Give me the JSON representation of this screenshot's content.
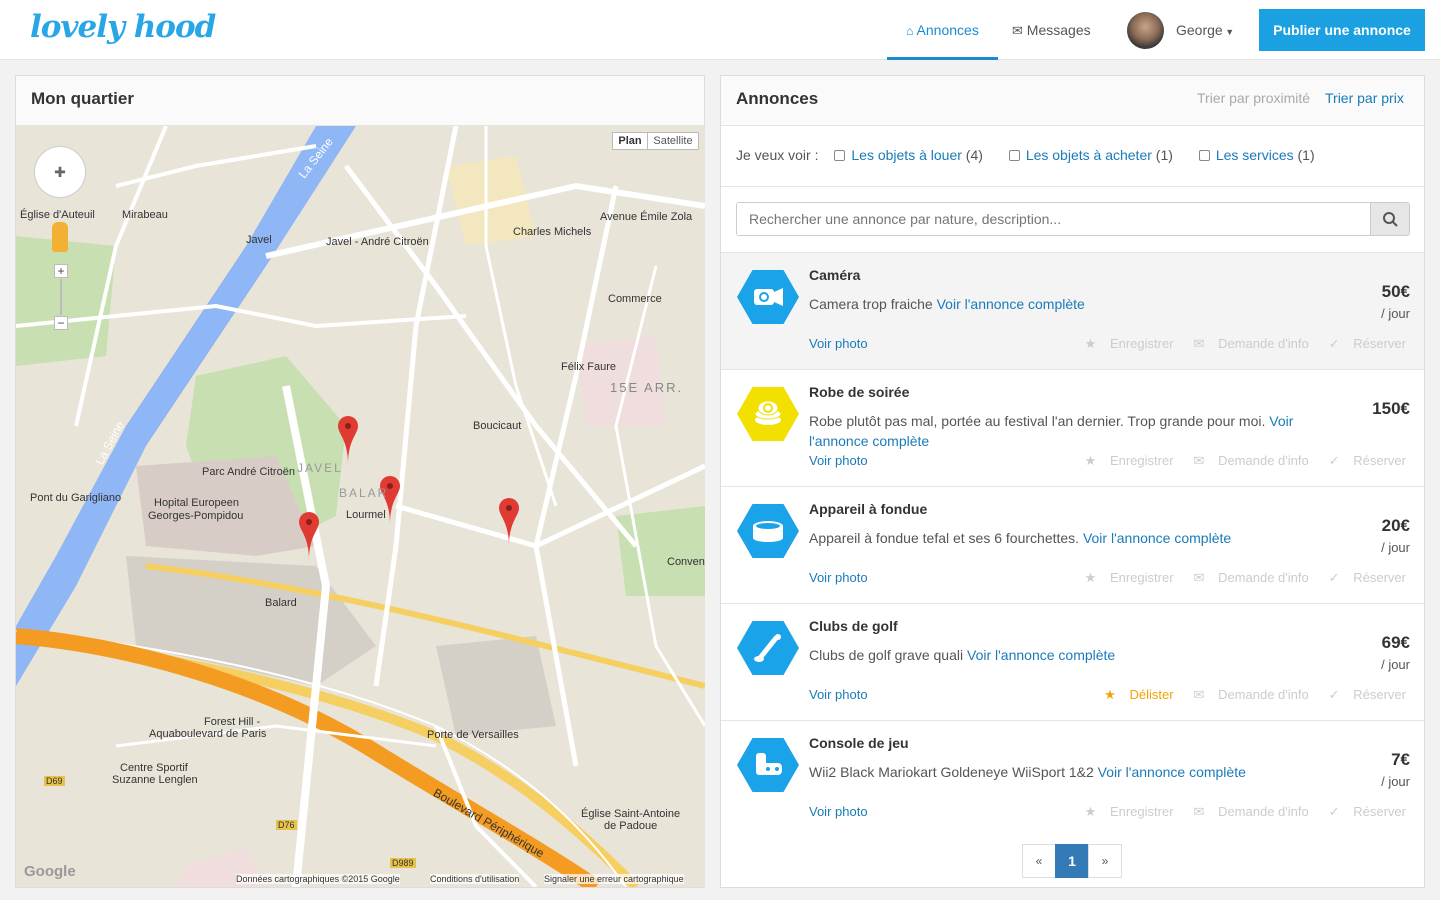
{
  "brand": {
    "logo": "lovely hood"
  },
  "nav": {
    "annonces": "Annonces",
    "messages": "Messages",
    "user": "George",
    "publish": "Publier une annonce"
  },
  "map_panel": {
    "title": "Mon quartier",
    "plan": "Plan",
    "satellite": "Satellite",
    "labels": {
      "seine1": "La Seine",
      "seine2": "La Seine",
      "eglise_auteuil": "Église d'Auteuil",
      "mirabeau": "Mirabeau",
      "javel": "Javel",
      "javel_citroen": "Javel - André Citroën",
      "charles_michels": "Charles Michels",
      "avenue_zola": "Avenue Émile Zola",
      "commerce": "Commerce",
      "felix_faure": "Félix Faure",
      "arr15": "15E ARR.",
      "boucicaut": "Boucicaut",
      "parc": "Parc André Citroën",
      "pont": "Pont du Garigliano",
      "hopital": "Hopital Europeen",
      "hopital2": "Georges-Pompidou",
      "lourmel": "Lourmel",
      "javel_district": "JAVEL",
      "balard_district": "BALAR",
      "balard": "Balard",
      "forest_hill": "Forest Hill -",
      "aquaboulevard": "Aquaboulevard de Paris",
      "centre_sportif": "Centre Sportif",
      "suzanne": "Suzanne Lenglen",
      "porte_versailles": "Porte de Versailles",
      "boulevard_peripherique": "Boulevard Périphérique",
      "eglise_antoine": "Église Saint-Antoine",
      "de_padoue": "de Padoue",
      "conven": "Conven",
      "google": "Google",
      "attribution": "Données cartographiques ©2015 Google",
      "conditions": "Conditions d'utilisation",
      "signaler": "Signaler une erreur cartographique",
      "d69": "D69",
      "d76": "D76",
      "d989": "D989"
    }
  },
  "listings_panel": {
    "title": "Annonces",
    "sort_proximity": "Trier par proximité",
    "sort_price": "Trier par prix",
    "filter_intro": "Je veux voir :",
    "filters": [
      {
        "label": "Les objets à louer",
        "count": "(4)"
      },
      {
        "label": "Les objets à acheter",
        "count": "(1)"
      },
      {
        "label": "Les services",
        "count": "(1)"
      }
    ],
    "search_placeholder": "Rechercher une annonce par nature, description...",
    "full_link": "Voir l'annonce complète",
    "photo_link": "Voir photo",
    "per_day": "/ jour",
    "action_save": "Enregistrer",
    "action_unsave": "Délister",
    "action_info": "Demande d'info",
    "action_reserve": "Réserver",
    "items": [
      {
        "title": "Caméra",
        "desc": "Camera trop fraiche",
        "price": "50€",
        "color": "#1aa3e8",
        "icon": "camera-icon"
      },
      {
        "title": "Robe de soirée",
        "desc": "Robe plutôt pas mal, portée au festival l'an dernier. Trop grande pour moi.",
        "price": "150€",
        "color": "#f2e000",
        "icon": "coins-icon"
      },
      {
        "title": "Appareil à fondue",
        "desc": "Appareil à fondue tefal et ses 6 fourchettes.",
        "price": "20€",
        "color": "#1aa3e8",
        "icon": "fondue-icon"
      },
      {
        "title": "Clubs de golf",
        "desc": "Clubs de golf grave quali",
        "price": "69€",
        "color": "#1aa3e8",
        "icon": "golf-icon"
      },
      {
        "title": "Console de jeu",
        "desc": "Wii2 Black Mariokart Goldeneye WiiSport 1&2",
        "price": "7€",
        "color": "#1aa3e8",
        "icon": "gamepad-icon"
      }
    ],
    "pager": {
      "prev": "«",
      "current": "1",
      "next": "»"
    }
  }
}
